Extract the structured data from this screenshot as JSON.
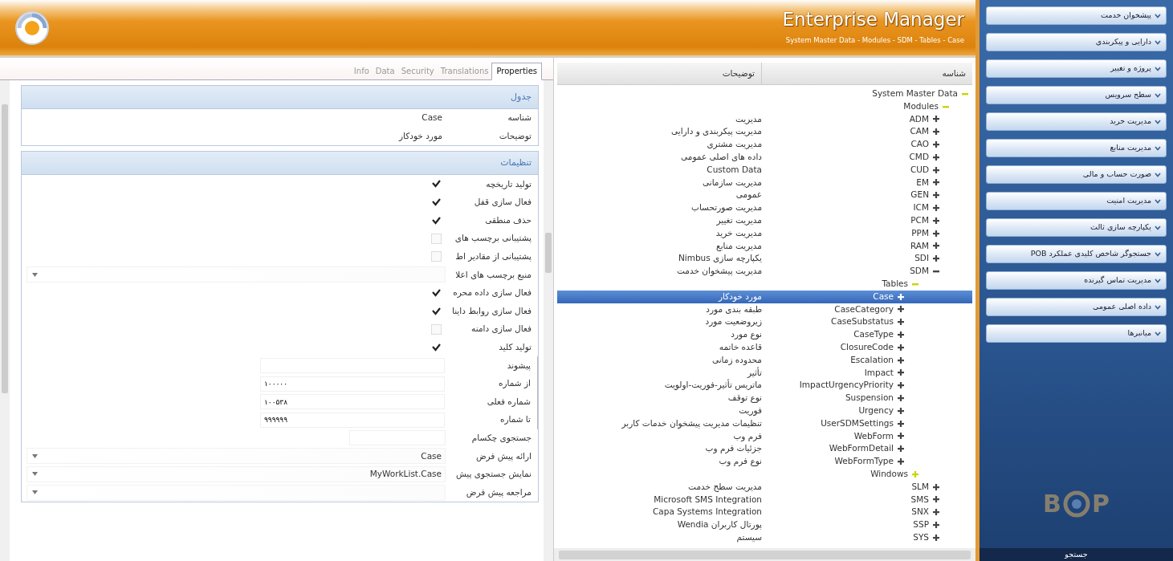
{
  "header": {
    "title": "Enterprise Manager",
    "breadcrumb": "System Master Data - Modules - SDM - Tables - Case"
  },
  "properties_panel": {
    "tabs": [
      {
        "label": "Properties",
        "selected": true
      },
      {
        "label": "Translations",
        "selected": false
      },
      {
        "label": "Security",
        "selected": false
      },
      {
        "label": "Data",
        "selected": false
      },
      {
        "label": "Info",
        "selected": false
      }
    ],
    "sections": [
      {
        "title": "جدول",
        "rows": [
          {
            "kind": "text",
            "label": "شناسه",
            "value": "Case"
          },
          {
            "kind": "text",
            "label": "توضیحات",
            "value": "مورد خودکار"
          }
        ]
      },
      {
        "title": "تنظیمات",
        "rows": [
          {
            "kind": "checkbox",
            "label": "تولید تاریخچه",
            "checked": true
          },
          {
            "kind": "checkbox",
            "label": "فعال سازی قفل",
            "checked": true
          },
          {
            "kind": "checkbox",
            "label": "حذف منطقی",
            "checked": true
          },
          {
            "kind": "checkbox",
            "label": "پشتیبانی برچسب های",
            "checked": false
          },
          {
            "kind": "checkbox",
            "label": "پشتیبانی از مقادیر اط",
            "checked": false
          },
          {
            "kind": "dropdown",
            "label": "منبع برچسب های اعلا"
          },
          {
            "kind": "checkbox",
            "label": "فعال سازی داده محره",
            "checked": true
          },
          {
            "kind": "checkbox",
            "label": "فعال سازی روابط داینا",
            "checked": true
          },
          {
            "kind": "checkbox",
            "label": "فعال سازی دامنه",
            "checked": false
          },
          {
            "kind": "checkbox",
            "label": "تولید کلید",
            "checked": true
          },
          {
            "kind": "group",
            "children": [
              {
                "label": "پیشوند"
              },
              {
                "label": "از شماره",
                "value": "۱۰۰۰۰۰"
              },
              {
                "label": "شماره فعلی",
                "value": "۱۰۰۵۳۸"
              },
              {
                "label": "تا شماره",
                "value": "۹۹۹۹۹۹"
              }
            ]
          },
          {
            "kind": "field",
            "label": "جستجوی چکسام"
          },
          {
            "kind": "dropdown",
            "label": "ارائه پیش فرض",
            "value": "Case"
          },
          {
            "kind": "dropdown",
            "label": "نمایش جستجوی پیش",
            "value": "MyWorkList.Case"
          },
          {
            "kind": "dropdown",
            "label": "مراجعه پیش فرض"
          }
        ]
      }
    ]
  },
  "tree": {
    "columns": [
      "شناسه",
      "توضیحات"
    ],
    "rows": [
      {
        "id": "System Master Data",
        "expanded": true,
        "selected": false,
        "children": [
          {
            "id": "Modules",
            "expanded": true,
            "selected": false,
            "children": [
              {
                "id": "ADM",
                "description": "مدیریت",
                "expanded": false,
                "selected": false
              },
              {
                "id": "CAM",
                "description": "مدیریت پیکربندی و دارایی",
                "expanded": false,
                "selected": false
              },
              {
                "id": "CAO",
                "description": "مدیریت مشتری",
                "expanded": false,
                "selected": false
              },
              {
                "id": "CMD",
                "description": "داده های اصلی عمومی",
                "expanded": false,
                "selected": false
              },
              {
                "id": "CUD",
                "description": "Custom Data",
                "expanded": false,
                "selected": false
              },
              {
                "id": "EM",
                "description": "مدیریت سازمانی",
                "expanded": false,
                "selected": false
              },
              {
                "id": "GEN",
                "description": "عمومی",
                "expanded": false,
                "selected": false
              },
              {
                "id": "ICM",
                "description": "مدیریت صورتحساب",
                "expanded": false,
                "selected": false
              },
              {
                "id": "PCM",
                "description": "مدیریت تغییر",
                "expanded": false,
                "selected": false
              },
              {
                "id": "PPM",
                "description": "مدیریت خرید",
                "expanded": false,
                "selected": false
              },
              {
                "id": "RAM",
                "description": "مدیریت منابع",
                "expanded": false,
                "selected": false
              },
              {
                "id": "SDI",
                "description": "یکپارچه سازی Nimbus",
                "expanded": false,
                "selected": false
              },
              {
                "id": "SDM",
                "description": "مدیریت پیشخوان خدمت",
                "expanded": true,
                "selected": false,
                "children": [
                  {
                    "id": "Tables",
                    "expanded": true,
                    "selected": false,
                    "children": [
                      {
                        "id": "Case",
                        "description": "مورد خودکار",
                        "expanded": false,
                        "selected": true
                      },
                      {
                        "id": "CaseCategory",
                        "description": "طبقه بندی مورد",
                        "expanded": false,
                        "selected": false
                      },
                      {
                        "id": "CaseSubstatus",
                        "description": "زیروضعیت مورد",
                        "expanded": false,
                        "selected": false
                      },
                      {
                        "id": "CaseType",
                        "description": "نوع مورد",
                        "expanded": false,
                        "selected": false
                      },
                      {
                        "id": "ClosureCode",
                        "description": "قاعده خاتمه",
                        "expanded": false,
                        "selected": false
                      },
                      {
                        "id": "Escalation",
                        "description": "محدوده زمانی",
                        "expanded": false,
                        "selected": false
                      },
                      {
                        "id": "Impact",
                        "description": "تأثیر",
                        "expanded": false,
                        "selected": false
                      },
                      {
                        "id": "ImpactUrgencyPriority",
                        "description": "ماتریس تأثیر-فوریت-اولویت",
                        "expanded": false,
                        "selected": false
                      },
                      {
                        "id": "Suspension",
                        "description": "نوع توقف",
                        "expanded": false,
                        "selected": false
                      },
                      {
                        "id": "Urgency",
                        "description": "فوریت",
                        "expanded": false,
                        "selected": false
                      },
                      {
                        "id": "UserSDMSettings",
                        "description": "تنظیمات مدیریت پیشخوان خدمات کاربر",
                        "expanded": false,
                        "selected": false
                      },
                      {
                        "id": "WebForm",
                        "description": "فرم وب",
                        "expanded": false,
                        "selected": false
                      },
                      {
                        "id": "WebFormDetail",
                        "description": "جزئیات فرم وب",
                        "expanded": false,
                        "selected": false
                      },
                      {
                        "id": "WebFormType",
                        "description": "نوع فرم وب",
                        "expanded": false,
                        "selected": false
                      }
                    ]
                  },
                  {
                    "id": "Windows",
                    "expanded": false,
                    "selected": false
                  }
                ]
              },
              {
                "id": "SLM",
                "description": "مدیریت سطح خدمت",
                "expanded": false,
                "selected": false
              },
              {
                "id": "SMS",
                "description": "Microsoft SMS Integration",
                "expanded": false,
                "selected": false
              },
              {
                "id": "SNX",
                "description": "Capa Systems Integration",
                "expanded": false,
                "selected": false
              },
              {
                "id": "SSP",
                "description": "پورتال کاربران Wendia",
                "expanded": false,
                "selected": false
              },
              {
                "id": "SYS",
                "description": "سیستم",
                "expanded": false,
                "selected": false
              }
            ]
          }
        ]
      }
    ]
  },
  "sidebar": {
    "items": [
      "پیشخوان خدمت",
      "دارایی و پیکربندی",
      "پروژه و تغییر",
      "سطح سرویس",
      "مدیریت خرید",
      "مدیریت منابع",
      "صورت حساب و مالی",
      "مدیریت امنیت",
      "یکپارچه سازی ثالث",
      "جستجوگر شاخص کلیدی عملکرد POB",
      "مدیریت تماس گیرنده",
      "داده اصلی عمومی",
      "میانبرها"
    ],
    "logo": {
      "left": "B",
      "right": "P"
    },
    "search_button": "جستجو"
  }
}
